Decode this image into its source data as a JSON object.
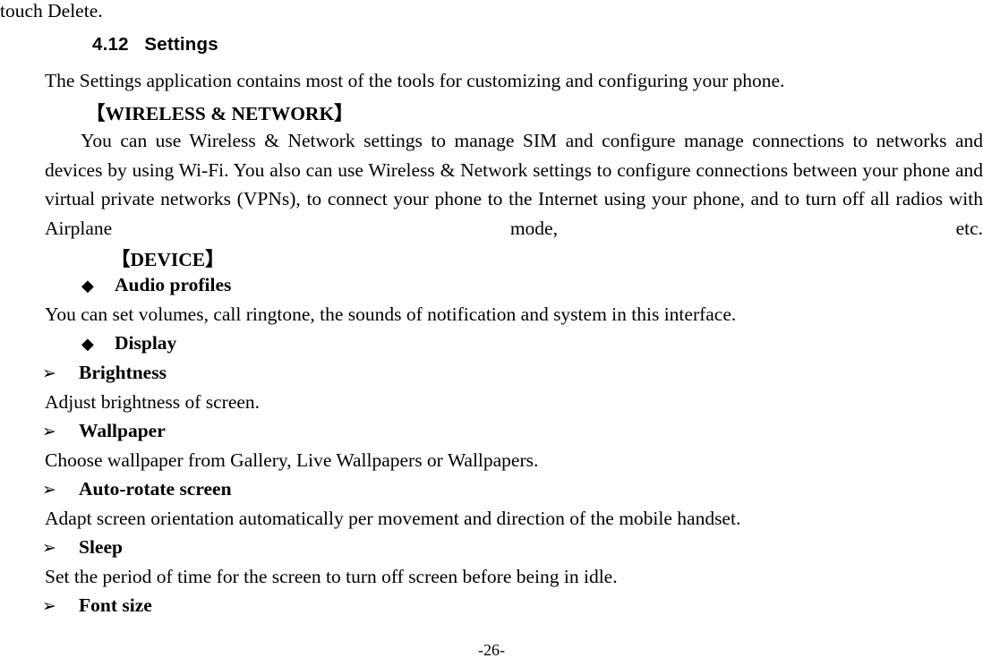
{
  "page": {
    "continuation_line": "touch Delete.",
    "page_number": "-26-"
  },
  "heading": {
    "number": "4.12",
    "title": "Settings",
    "full": "4.12   Settings"
  },
  "intro": {
    "paragraph": "The Settings application contains most of the tools for customizing and configuring your phone."
  },
  "sections": [
    {
      "bracket_label": "【WIRELESS & NETWORK】",
      "paragraph": "You can use Wireless & Network settings to manage SIM and configure manage connections to networks and devices by using Wi-Fi. You also can use Wireless & Network settings to configure connections between your phone and virtual private networks (VPNs), to connect your phone to the Internet using your phone, and to turn off all radios with Airplane mode, etc."
    },
    {
      "bracket_label": "【DEVICE】"
    }
  ],
  "bullets": {
    "diamond_glyph": "◆",
    "arrow_glyph": "➢",
    "items": [
      {
        "level": "diamond",
        "label": "Audio profiles",
        "description": "You can set volumes, call ringtone, the sounds of notification and system in this interface."
      },
      {
        "level": "diamond",
        "label": "Display",
        "description": ""
      },
      {
        "level": "arrow",
        "label": "Brightness",
        "description": "Adjust brightness of screen."
      },
      {
        "level": "arrow",
        "label": "Wallpaper",
        "description": "Choose wallpaper from Gallery, Live Wallpapers or Wallpapers."
      },
      {
        "level": "arrow",
        "label": "Auto-rotate screen",
        "description": "Adapt screen orientation automatically per movement and direction of the mobile handset."
      },
      {
        "level": "arrow",
        "label": "Sleep",
        "description": "Set the period of time for the screen to turn off screen before being in idle."
      },
      {
        "level": "arrow",
        "label": "Font size",
        "description": ""
      }
    ]
  }
}
